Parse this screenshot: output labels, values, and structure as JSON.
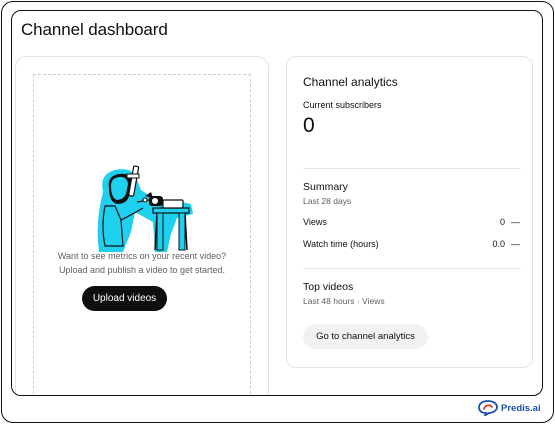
{
  "page": {
    "title": "Channel dashboard"
  },
  "upload_card": {
    "prompt_line1": "Want to see metrics on your recent video?",
    "prompt_line2": "Upload and publish a video to get started.",
    "upload_button": "Upload videos",
    "illustration_icon": "person-with-camera-illustration"
  },
  "analytics": {
    "title": "Channel analytics",
    "subscribers_label": "Current subscribers",
    "subscribers_value": "0",
    "summary": {
      "title": "Summary",
      "period": "Last 28 days",
      "rows": [
        {
          "label": "Views",
          "value": "0",
          "change": "—"
        },
        {
          "label": "Watch time (hours)",
          "value": "0.0",
          "change": "—"
        }
      ]
    },
    "top_videos": {
      "title": "Top videos",
      "period": "Last 48 hours · Views"
    },
    "go_button": "Go to channel analytics"
  },
  "brand": {
    "name": "Predis.ai",
    "icon": "predis-logo-icon",
    "color": "#1a4fb8"
  },
  "colors": {
    "accent_cyan": "#1fd0ee",
    "button_dark": "#0f0f0f",
    "button_light": "#f2f2f2"
  }
}
